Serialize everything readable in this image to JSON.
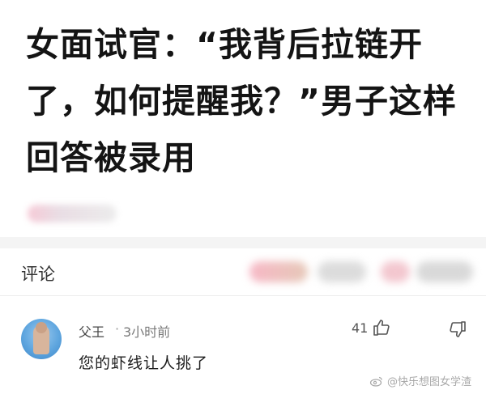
{
  "article": {
    "headline": "女面试官：“我背后拉链开了，如何提醒我？”男子这样回答被录用"
  },
  "comments_section": {
    "heading": "评论"
  },
  "comments": [
    {
      "username": "父王",
      "dot": "·",
      "timestamp": "3小时前",
      "text": "您的虾线让人挑了",
      "like_count": "41",
      "icons": {
        "like": "thumbs-up-icon",
        "dislike": "thumbs-down-icon"
      }
    }
  ],
  "watermark": {
    "text": "@快乐想图女学渣",
    "icon": "weibo-icon"
  },
  "colors": {
    "headline": "#141414",
    "muted": "#7a7a7a",
    "divider": "#f4f4f4",
    "avatar_bg": "#5fa6df"
  }
}
